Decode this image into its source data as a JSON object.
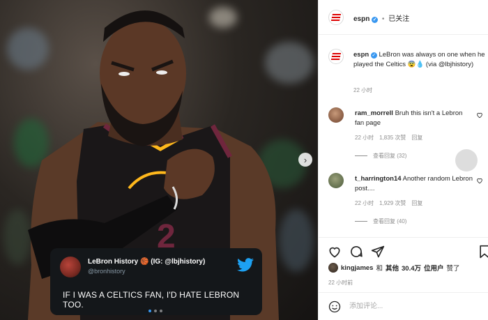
{
  "post": {
    "account": "espn",
    "follow_status": "已关注",
    "separator": "•"
  },
  "media": {
    "tweet": {
      "name": "LeBron History 🏀 (IG: @lbjhistory)",
      "handle": "@bronhistory",
      "text": "IF I WAS A CELTICS FAN, I'D HATE LEBRON TOO."
    },
    "carousel": {
      "count": 3,
      "active": 0
    },
    "next_icon": "chevron-right-icon"
  },
  "caption": {
    "username": "espn",
    "text": "LeBron was always on one when he played the Celtics 😨💧 (via @lbjhistory)",
    "time": "22 小时"
  },
  "comments": [
    {
      "username": "ram_morrell",
      "text": "Bruh this isn't a Lebron fan page",
      "time": "22 小时",
      "likes": "1,835 次赞",
      "reply": "回复",
      "view_replies": "查看回复 (32)"
    },
    {
      "username": "t_harrington14",
      "text": "Another random Lebron post....",
      "time": "22 小时",
      "likes": "1,929 次赞",
      "reply": "回复",
      "view_replies": "查看回复 (40)"
    }
  ],
  "likes": {
    "user": "kingjames",
    "and": "和",
    "others": "其他",
    "count": "30.4万",
    "suffix": "位用户",
    "liked": "赞了"
  },
  "post_time": "22 小时前",
  "comment_box": {
    "placeholder": "添加评论..."
  },
  "colors": {
    "espn_red": "#dd0000",
    "verified_blue": "#3897f0",
    "twitter_blue": "#1da1f2",
    "cavs_wine": "#6f263d",
    "cavs_gold": "#ffb81c"
  }
}
